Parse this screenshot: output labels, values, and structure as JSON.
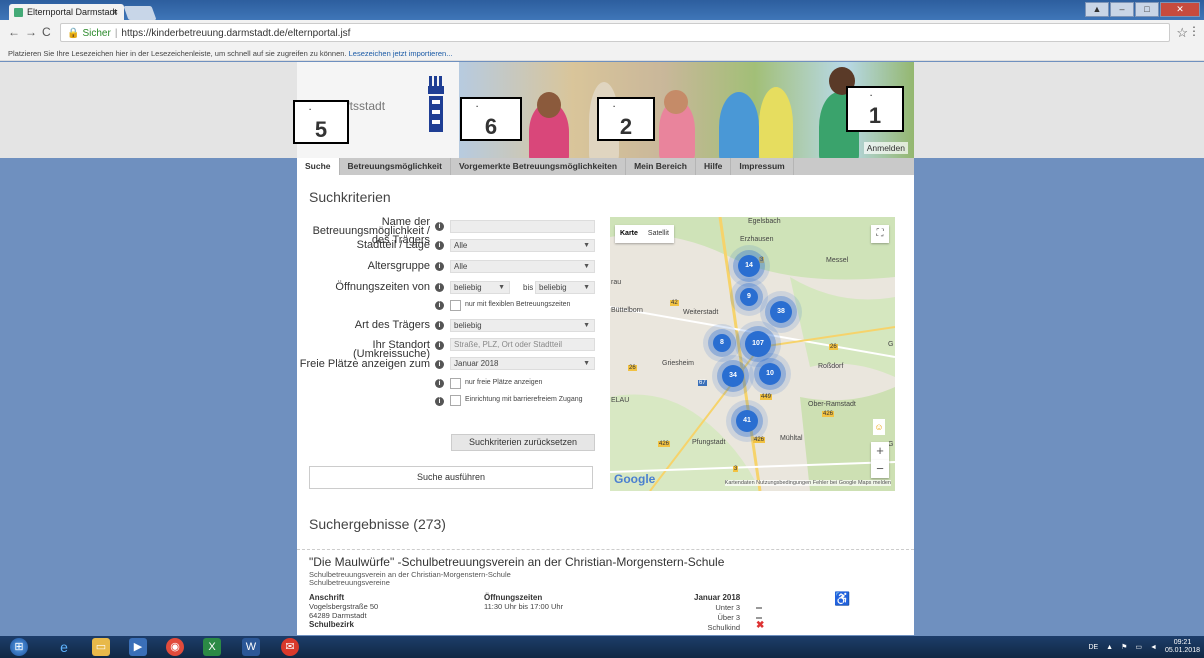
{
  "browser": {
    "tab_title": "Elternportal Darmstadt",
    "tab_close": "×",
    "secure_label": "Sicher",
    "url": "https://kinderbetreuung.darmstadt.de/elternportal.jsf",
    "url_sep": "|",
    "bookmarks_hint": "Platzieren Sie Ihre Lesezeichen hier in der Lesezeichenleiste, um schnell auf sie zugreifen zu können.",
    "bookmarks_link": "Lesezeichen jetzt importieren..."
  },
  "header": {
    "city_line1": "chaftsstadt",
    "city_line2": "adt",
    "login_label": "Anmelden",
    "annotations": [
      {
        "number": "5",
        "dot": "."
      },
      {
        "number": "6",
        "dot": "."
      },
      {
        "number": "2",
        "dot": "."
      },
      {
        "number": "1",
        "dot": "."
      }
    ]
  },
  "nav_tabs": [
    "Suche",
    "Betreuungsmöglichkeit",
    "Vorgemerkte Betreuungsmöglichkeiten",
    "Mein Bereich",
    "Hilfe",
    "Impressum"
  ],
  "search": {
    "title": "Suchkriterien",
    "name_label": "Name der Betreuungsmöglichkeit / des Trägers",
    "district_label": "Stadtteil / Lage",
    "district_value": "Alle",
    "age_label": "Altersgruppe",
    "age_value": "Alle",
    "hours_label": "Öffnungszeiten von",
    "hours_from": "beliebig",
    "hours_to_label": "bis",
    "hours_to": "beliebig",
    "flexible_label": "nur mit flexiblen Betreuungszeiten",
    "carrier_label": "Art des Trägers",
    "carrier_value": "beliebig",
    "location_label": "Ihr Standort (Umkreissuche)",
    "location_placeholder": "Straße, PLZ, Ort oder Stadtteil",
    "free_label": "Freie Plätze anzeigen zum",
    "free_value": "Januar 2018",
    "only_free_label": "nur freie Plätze anzeigen",
    "barrier_free_label": "Einrichtung mit barrierefreiem Zugang",
    "reset_button": "Suchkriterien zurücksetzen",
    "search_button": "Suche ausführen"
  },
  "map": {
    "type_map": "Karte",
    "type_satellite": "Satellit",
    "places": [
      "Egelsbach",
      "Erzhausen",
      "Messel",
      "Büttelborn",
      "Weiterstadt",
      "Griesheim",
      "Roßdorf",
      "Ober-Ramstadt",
      "Pfungstadt",
      "Mühltal",
      "rau",
      "ELAU"
    ],
    "clusters": [
      "14",
      "9",
      "38",
      "8",
      "107",
      "34",
      "10",
      "41"
    ],
    "road_signs": [
      "3",
      "42",
      "26",
      "26",
      "449",
      "426",
      "426",
      "426",
      "3",
      "67",
      "G",
      "G"
    ],
    "zoom_in": "+",
    "zoom_out": "−",
    "google": "Google",
    "footer": "Kartendaten   Nutzungsbedingungen   Fehler bei Google Maps melden"
  },
  "results": {
    "title": "Suchergebnisse (273)",
    "item": {
      "name": "\"Die Maulwürfe\" -Schulbetreuungsverein an der Christian-Morgenstern-Schule",
      "sub1": "Schulbetreuungsverein an der Christian-Morgenstern-Schule",
      "sub2": "Schulbetreuungsvereine",
      "address_label": "Anschrift",
      "street": "Vogelsbergstraße 50",
      "city": "64289 Darmstadt",
      "district_label": "Schulbezirk",
      "hours_label": "Öffnungszeiten",
      "hours": "11:30 Uhr bis 17:00 Uhr",
      "month": "Januar 2018",
      "under3": "Unter 3",
      "over3": "Über 3",
      "schoolchild": "Schulkind",
      "schoolchild_mark": "✖",
      "wheelchair": "♿"
    }
  },
  "taskbar": {
    "lang": "DE",
    "time": "09:21",
    "date": "05.01.2018"
  }
}
